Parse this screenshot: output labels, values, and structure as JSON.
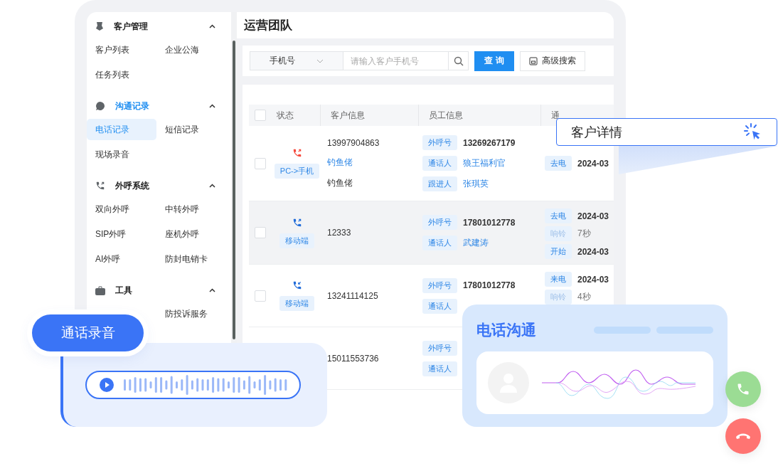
{
  "sidebar": {
    "groups": [
      {
        "title": "客户管理",
        "active": false,
        "expanded": true,
        "items": [
          {
            "label": "客户列表",
            "selected": false
          },
          {
            "label": "企业公海",
            "selected": false
          },
          {
            "label": "任务列表",
            "selected": false
          }
        ]
      },
      {
        "title": "沟通记录",
        "active": true,
        "expanded": true,
        "items": [
          {
            "label": "电话记录",
            "selected": true
          },
          {
            "label": "短信记录",
            "selected": false
          },
          {
            "label": "现场录音",
            "selected": false
          }
        ]
      },
      {
        "title": "外呼系统",
        "active": false,
        "expanded": true,
        "items": [
          {
            "label": "双向外呼",
            "selected": false
          },
          {
            "label": "中转外呼",
            "selected": false
          },
          {
            "label": "SIP外呼",
            "selected": false
          },
          {
            "label": "座机外呼",
            "selected": false
          },
          {
            "label": "AI外呼",
            "selected": false
          },
          {
            "label": "防封电销卡",
            "selected": false
          }
        ]
      },
      {
        "title": "工具",
        "active": false,
        "expanded": true,
        "items": [
          {
            "label": "防投诉服务",
            "selected": false
          }
        ]
      }
    ]
  },
  "page_title": "运营团队",
  "search": {
    "field_select": "手机号",
    "placeholder": "请输入客户手机号",
    "query_button": "查 询",
    "advanced_button": "高级搜索"
  },
  "table": {
    "all_checked": false,
    "columns": [
      "状态",
      "客户信息",
      "员工信息",
      "通"
    ],
    "rows": [
      {
        "checked": false,
        "highlighted": false,
        "color": "#f5483b",
        "kind": "outgoing",
        "channel": "PC->手机",
        "customer_phone": "13997904863",
        "customer_name": "钓鱼佬",
        "customer_note": "钓鱼佬",
        "staff": [
          {
            "label": "外呼号",
            "value": "13269267179",
            "link": false
          },
          {
            "label": "通话人",
            "value": "狼王福利官",
            "link": true
          },
          {
            "label": "跟进人",
            "value": "张琪英",
            "link": true
          }
        ],
        "times": [
          {
            "label": "去电",
            "value": "2024-03",
            "muted": false
          }
        ]
      },
      {
        "checked": false,
        "highlighted": true,
        "color": "#1f6bd9",
        "kind": "outgoing",
        "channel": "移动端",
        "customer_phone": "12333",
        "staff": [
          {
            "label": "外呼号",
            "value": "17801012778",
            "link": false
          },
          {
            "label": "通话人",
            "value": "武建涛",
            "link": true
          }
        ],
        "times": [
          {
            "label": "去电",
            "value": "2024-03",
            "muted": false
          },
          {
            "label": "响铃",
            "value": "7秒",
            "muted": true
          },
          {
            "label": "开始",
            "value": "2024-03",
            "muted": false
          }
        ]
      },
      {
        "checked": false,
        "highlighted": false,
        "color": "#1f6bd9",
        "kind": "incoming",
        "channel": "移动端",
        "customer_phone": "13241114125",
        "staff": [
          {
            "label": "外呼号",
            "value": "17801012778",
            "link": false
          },
          {
            "label": "通话人"
          }
        ],
        "times": [
          {
            "label": "来电",
            "value": "2024-03",
            "muted": false
          },
          {
            "label": "响铃",
            "value": "4秒",
            "muted": true
          }
        ]
      },
      {
        "highlighted": false,
        "customer_phone": "15011553736",
        "staff": [
          {
            "label": "外呼号"
          },
          {
            "label": "通话人"
          }
        ],
        "times": []
      }
    ]
  },
  "recording": {
    "title": "通话录音"
  },
  "customer_popup": {
    "label": "客户详情"
  },
  "phone_card": {
    "title": "电话沟通"
  }
}
